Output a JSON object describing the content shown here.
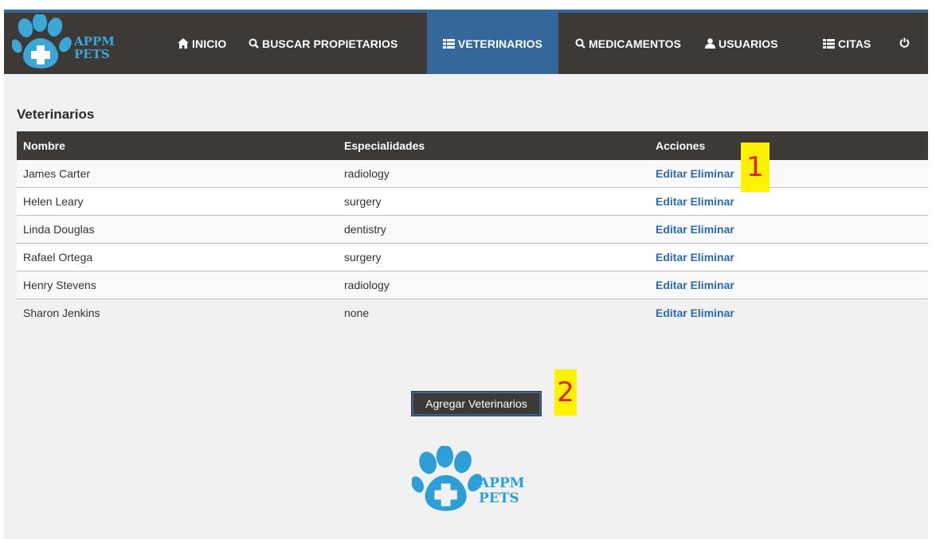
{
  "brand": {
    "line1": "APPM",
    "line2": "PETS"
  },
  "nav": {
    "items": [
      {
        "label": "INICIO",
        "icon": "home-icon"
      },
      {
        "label": "BUSCAR PROPIETARIOS",
        "icon": "search-icon"
      },
      {
        "label": "VETERINARIOS",
        "icon": "list-icon",
        "active": true
      },
      {
        "label": "MEDICAMENTOS",
        "icon": "search-icon"
      },
      {
        "label": "USUARIOS",
        "icon": "user-icon"
      },
      {
        "label": "CITAS",
        "icon": "list-icon"
      }
    ],
    "power_icon": "power-icon"
  },
  "page": {
    "title": "Veterinarios"
  },
  "table": {
    "headers": [
      "Nombre",
      "Especialidades",
      "Acciones"
    ],
    "rows": [
      {
        "name": "James Carter",
        "specialty": "radiology",
        "edit": "Editar",
        "delete": "Eliminar"
      },
      {
        "name": "Helen Leary",
        "specialty": "surgery",
        "edit": "Editar",
        "delete": "Eliminar"
      },
      {
        "name": "Linda Douglas",
        "specialty": "dentistry",
        "edit": "Editar",
        "delete": "Eliminar"
      },
      {
        "name": "Rafael Ortega",
        "specialty": "surgery",
        "edit": "Editar",
        "delete": "Eliminar"
      },
      {
        "name": "Henry Stevens",
        "specialty": "radiology",
        "edit": "Editar",
        "delete": "Eliminar"
      },
      {
        "name": "Sharon Jenkins",
        "specialty": "none",
        "edit": "Editar",
        "delete": "Eliminar"
      }
    ]
  },
  "add_button": {
    "label": "Agregar Veterinarios"
  },
  "markers": {
    "one": "1",
    "two": "2"
  },
  "footer": {
    "line1": "APPM",
    "line2": "PETS"
  },
  "colors": {
    "navbar": "#3c3937",
    "accent": "#34689a",
    "link": "#2b6aab",
    "brand": "#3aa7d6",
    "marker_bg": "#fff200",
    "marker_text": "#e0211b"
  }
}
